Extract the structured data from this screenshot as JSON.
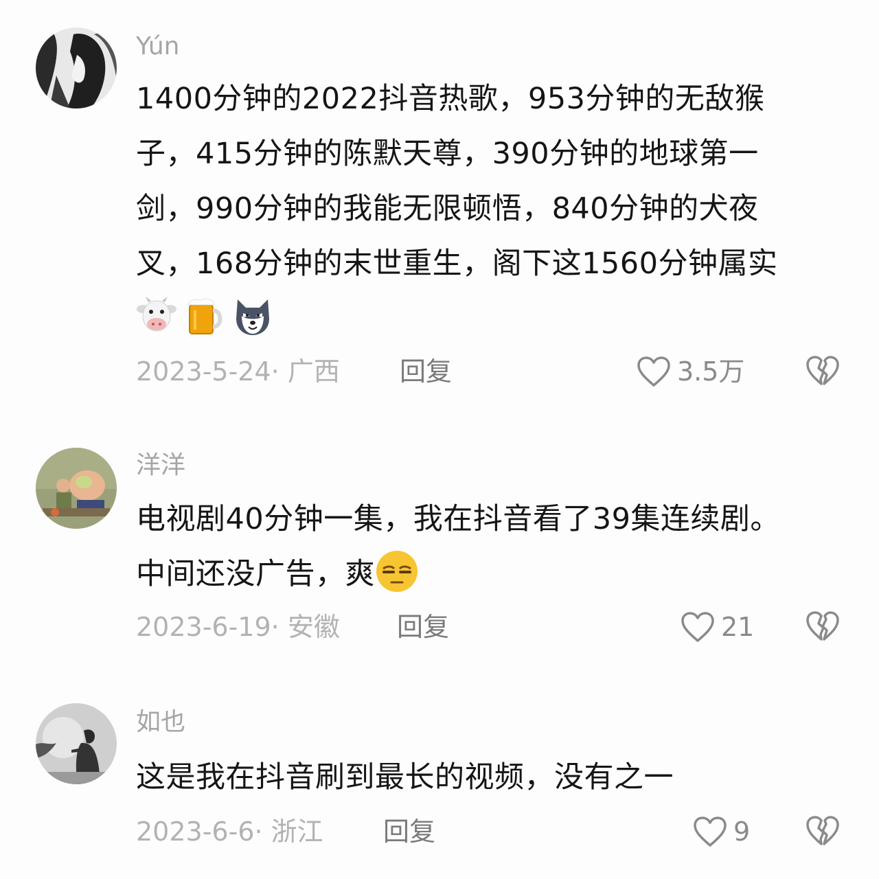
{
  "comments": [
    {
      "username": "Yún",
      "lines": [
        "1400分钟的2022抖音热歌，953分钟的无敌猴",
        "子，415分钟的陈默天尊，390分钟的地球第一",
        "剑，990分钟的我能无限顿悟，840分钟的犬夜",
        "叉，168分钟的末世重生，阁下这1560分钟属实"
      ],
      "emojis": [
        "cow-emoji",
        "beer-emoji",
        "wolf-emoji"
      ],
      "date": "2023-5-24",
      "location": "广西",
      "reply_label": "回复",
      "likes": "3.5万"
    },
    {
      "username": "洋洋",
      "lines": [
        "电视剧40分钟一集，我在抖音看了39集连续剧。",
        "中间还没广告，爽"
      ],
      "emojis": [
        "unamused-face-emoji"
      ],
      "date": "2023-6-19",
      "location": "安徽",
      "reply_label": "回复",
      "likes": "21"
    },
    {
      "username": "如也",
      "lines": [
        "这是我在抖音刷到最长的视频，没有之一"
      ],
      "emojis": [],
      "date": "2023-6-6",
      "location": "浙江",
      "reply_label": "回复",
      "likes": "9"
    }
  ],
  "meta_separator": "· ",
  "colors": {
    "text": "#151515",
    "muted": "#b2b2b2",
    "reply": "#7a7a7a",
    "background": "#fdfdfd"
  }
}
